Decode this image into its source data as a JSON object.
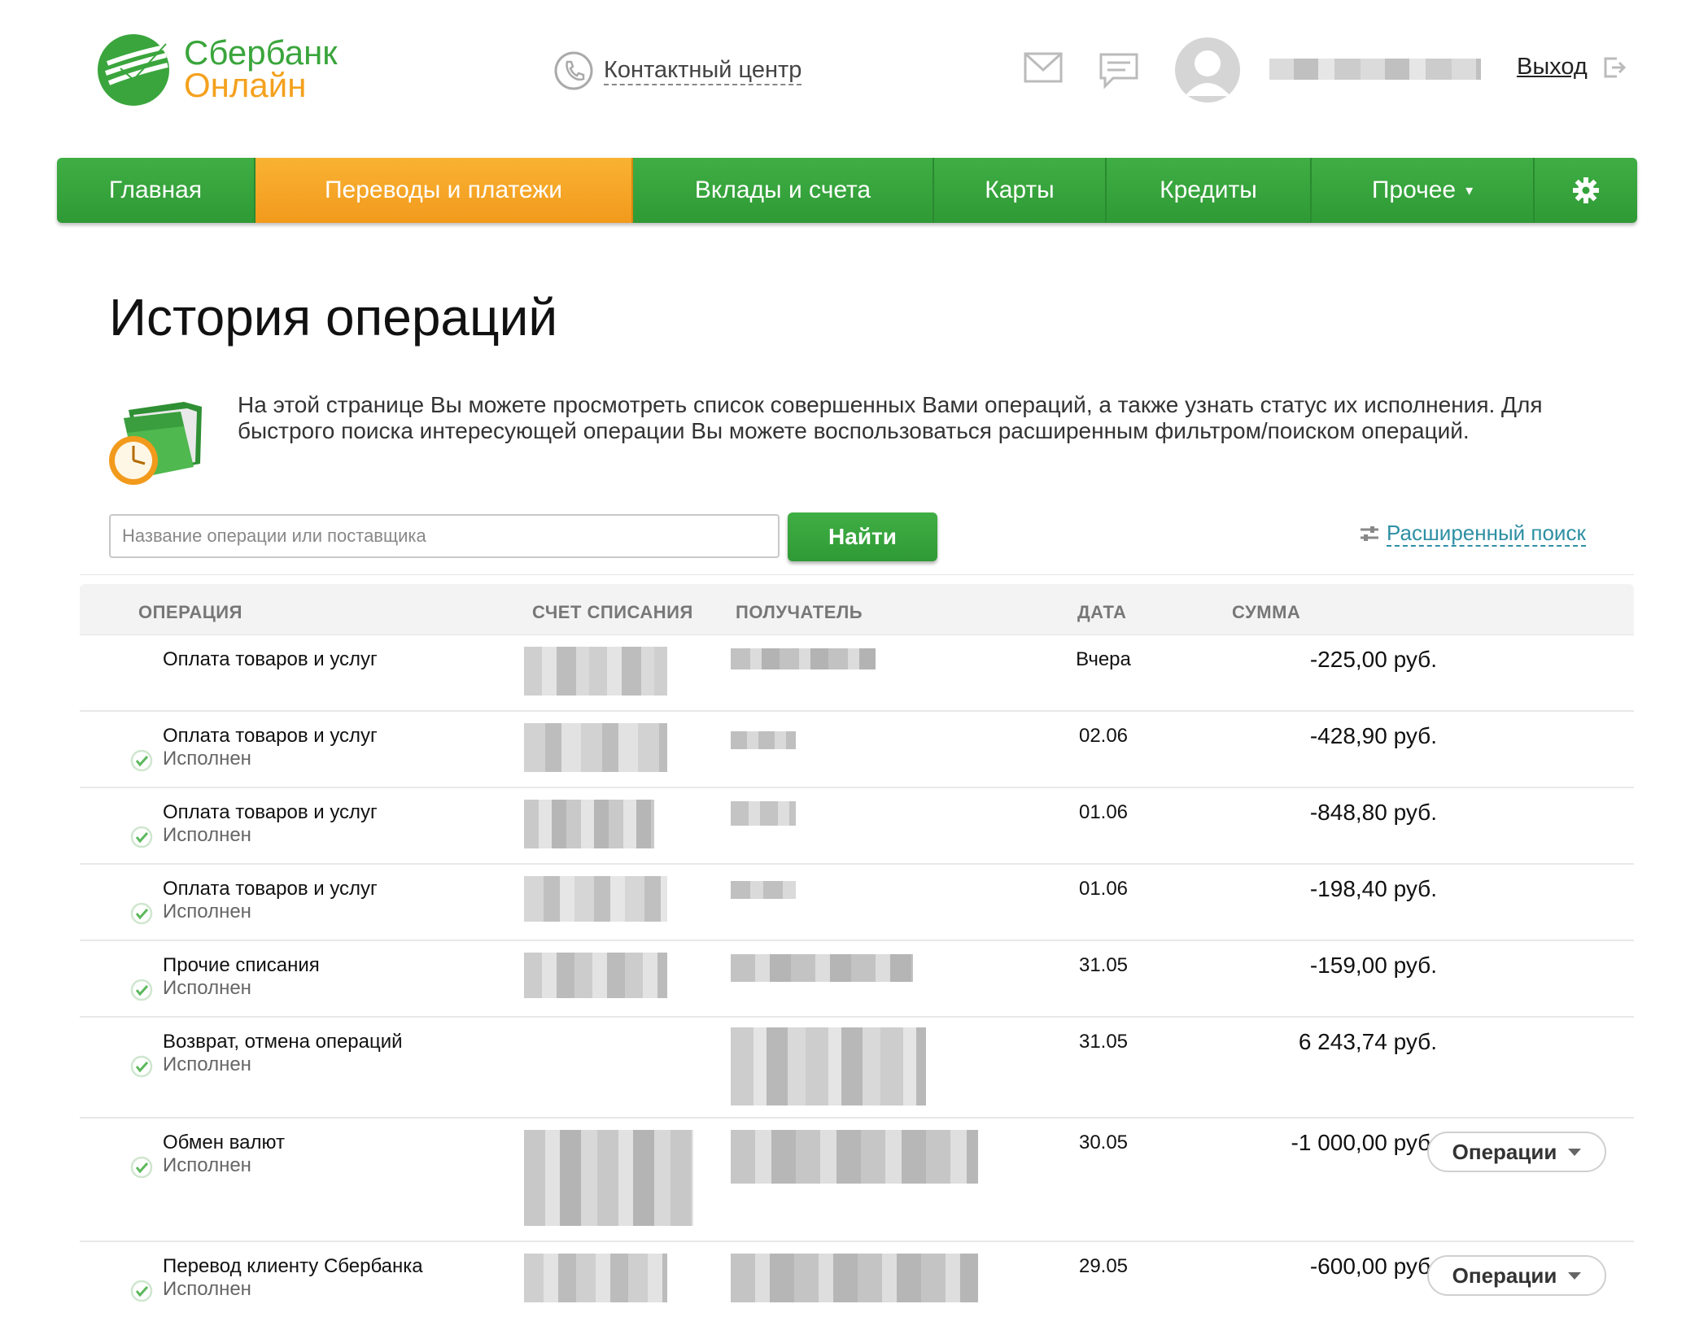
{
  "header": {
    "logo_line1": "Сбербанк",
    "logo_line2": "Онлайн",
    "contact_center": "Контактный центр",
    "logout": "Выход"
  },
  "nav": {
    "items": [
      {
        "label": "Главная"
      },
      {
        "label": "Переводы и платежи"
      },
      {
        "label": "Вклады и счета"
      },
      {
        "label": "Карты"
      },
      {
        "label": "Кредиты"
      },
      {
        "label": "Прочее"
      }
    ],
    "active": "Переводы и платежи"
  },
  "page": {
    "title": "История операций",
    "intro": "На этой странице Вы можете просмотреть список совершенных Вами операций, а также узнать статус их исполнения. Для быстрого поиска интересующей операции Вы можете воспользоваться расширенным фильтром/поиском операций."
  },
  "search": {
    "placeholder": "Название операции или поставщика",
    "button": "Найти",
    "advanced": "Расширенный поиск"
  },
  "table": {
    "headers": {
      "operation": "ОПЕРАЦИЯ",
      "account": "СЧЕТ СПИСАНИЯ",
      "recipient": "ПОЛУЧАТЕЛЬ",
      "date": "ДАТА",
      "sum": "СУММА"
    },
    "rows": [
      {
        "name": "Оплата товаров и услуг",
        "status": "",
        "date": "Вчера",
        "sum": "-225,00 руб.",
        "action": ""
      },
      {
        "name": "Оплата товаров и услуг",
        "status": "Исполнен",
        "date": "02.06",
        "sum": "-428,90 руб.",
        "action": ""
      },
      {
        "name": "Оплата товаров и услуг",
        "status": "Исполнен",
        "date": "01.06",
        "sum": "-848,80 руб.",
        "action": ""
      },
      {
        "name": "Оплата товаров и услуг",
        "status": "Исполнен",
        "date": "01.06",
        "sum": "-198,40 руб.",
        "action": ""
      },
      {
        "name": "Прочие списания",
        "status": "Исполнен",
        "date": "31.05",
        "sum": "-159,00 руб.",
        "action": ""
      },
      {
        "name": "Возврат, отмена операций",
        "status": "Исполнен",
        "date": "31.05",
        "sum": "6 243,74 руб.",
        "action": ""
      },
      {
        "name": "Обмен валют",
        "status": "Исполнен",
        "date": "30.05",
        "sum": "-1 000,00 руб.",
        "action": "Операции"
      },
      {
        "name": "Перевод клиенту Сбербанка",
        "status": "Исполнен",
        "date": "29.05",
        "sum": "-600,00 руб.",
        "action": "Операции"
      }
    ]
  },
  "colors": {
    "brand_green": "#3aa53c",
    "brand_orange": "#f4a11e",
    "link_teal": "#2d8fa3"
  },
  "icons": {
    "logo": "sberbank-logo-icon",
    "phone": "phone-icon",
    "mail": "mail-icon",
    "chat": "chat-icon",
    "avatar": "avatar-icon",
    "logout": "logout-icon",
    "settings": "gear-icon",
    "folder": "folder-clock-icon",
    "filter": "filter-icon",
    "status": "check-circle-icon"
  }
}
